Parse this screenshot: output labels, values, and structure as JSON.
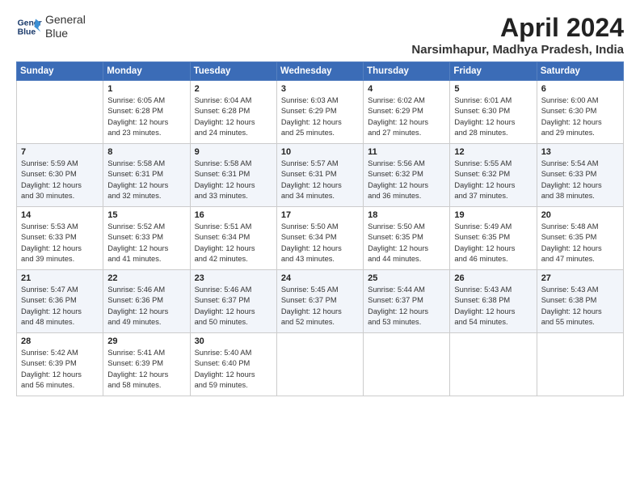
{
  "logo": {
    "line1": "General",
    "line2": "Blue"
  },
  "title": "April 2024",
  "subtitle": "Narsimhapur, Madhya Pradesh, India",
  "days_header": [
    "Sunday",
    "Monday",
    "Tuesday",
    "Wednesday",
    "Thursday",
    "Friday",
    "Saturday"
  ],
  "weeks": [
    [
      {
        "num": "",
        "content": ""
      },
      {
        "num": "1",
        "content": "Sunrise: 6:05 AM\nSunset: 6:28 PM\nDaylight: 12 hours\nand 23 minutes."
      },
      {
        "num": "2",
        "content": "Sunrise: 6:04 AM\nSunset: 6:28 PM\nDaylight: 12 hours\nand 24 minutes."
      },
      {
        "num": "3",
        "content": "Sunrise: 6:03 AM\nSunset: 6:29 PM\nDaylight: 12 hours\nand 25 minutes."
      },
      {
        "num": "4",
        "content": "Sunrise: 6:02 AM\nSunset: 6:29 PM\nDaylight: 12 hours\nand 27 minutes."
      },
      {
        "num": "5",
        "content": "Sunrise: 6:01 AM\nSunset: 6:30 PM\nDaylight: 12 hours\nand 28 minutes."
      },
      {
        "num": "6",
        "content": "Sunrise: 6:00 AM\nSunset: 6:30 PM\nDaylight: 12 hours\nand 29 minutes."
      }
    ],
    [
      {
        "num": "7",
        "content": "Sunrise: 5:59 AM\nSunset: 6:30 PM\nDaylight: 12 hours\nand 30 minutes."
      },
      {
        "num": "8",
        "content": "Sunrise: 5:58 AM\nSunset: 6:31 PM\nDaylight: 12 hours\nand 32 minutes."
      },
      {
        "num": "9",
        "content": "Sunrise: 5:58 AM\nSunset: 6:31 PM\nDaylight: 12 hours\nand 33 minutes."
      },
      {
        "num": "10",
        "content": "Sunrise: 5:57 AM\nSunset: 6:31 PM\nDaylight: 12 hours\nand 34 minutes."
      },
      {
        "num": "11",
        "content": "Sunrise: 5:56 AM\nSunset: 6:32 PM\nDaylight: 12 hours\nand 36 minutes."
      },
      {
        "num": "12",
        "content": "Sunrise: 5:55 AM\nSunset: 6:32 PM\nDaylight: 12 hours\nand 37 minutes."
      },
      {
        "num": "13",
        "content": "Sunrise: 5:54 AM\nSunset: 6:33 PM\nDaylight: 12 hours\nand 38 minutes."
      }
    ],
    [
      {
        "num": "14",
        "content": "Sunrise: 5:53 AM\nSunset: 6:33 PM\nDaylight: 12 hours\nand 39 minutes."
      },
      {
        "num": "15",
        "content": "Sunrise: 5:52 AM\nSunset: 6:33 PM\nDaylight: 12 hours\nand 41 minutes."
      },
      {
        "num": "16",
        "content": "Sunrise: 5:51 AM\nSunset: 6:34 PM\nDaylight: 12 hours\nand 42 minutes."
      },
      {
        "num": "17",
        "content": "Sunrise: 5:50 AM\nSunset: 6:34 PM\nDaylight: 12 hours\nand 43 minutes."
      },
      {
        "num": "18",
        "content": "Sunrise: 5:50 AM\nSunset: 6:35 PM\nDaylight: 12 hours\nand 44 minutes."
      },
      {
        "num": "19",
        "content": "Sunrise: 5:49 AM\nSunset: 6:35 PM\nDaylight: 12 hours\nand 46 minutes."
      },
      {
        "num": "20",
        "content": "Sunrise: 5:48 AM\nSunset: 6:35 PM\nDaylight: 12 hours\nand 47 minutes."
      }
    ],
    [
      {
        "num": "21",
        "content": "Sunrise: 5:47 AM\nSunset: 6:36 PM\nDaylight: 12 hours\nand 48 minutes."
      },
      {
        "num": "22",
        "content": "Sunrise: 5:46 AM\nSunset: 6:36 PM\nDaylight: 12 hours\nand 49 minutes."
      },
      {
        "num": "23",
        "content": "Sunrise: 5:46 AM\nSunset: 6:37 PM\nDaylight: 12 hours\nand 50 minutes."
      },
      {
        "num": "24",
        "content": "Sunrise: 5:45 AM\nSunset: 6:37 PM\nDaylight: 12 hours\nand 52 minutes."
      },
      {
        "num": "25",
        "content": "Sunrise: 5:44 AM\nSunset: 6:37 PM\nDaylight: 12 hours\nand 53 minutes."
      },
      {
        "num": "26",
        "content": "Sunrise: 5:43 AM\nSunset: 6:38 PM\nDaylight: 12 hours\nand 54 minutes."
      },
      {
        "num": "27",
        "content": "Sunrise: 5:43 AM\nSunset: 6:38 PM\nDaylight: 12 hours\nand 55 minutes."
      }
    ],
    [
      {
        "num": "28",
        "content": "Sunrise: 5:42 AM\nSunset: 6:39 PM\nDaylight: 12 hours\nand 56 minutes."
      },
      {
        "num": "29",
        "content": "Sunrise: 5:41 AM\nSunset: 6:39 PM\nDaylight: 12 hours\nand 58 minutes."
      },
      {
        "num": "30",
        "content": "Sunrise: 5:40 AM\nSunset: 6:40 PM\nDaylight: 12 hours\nand 59 minutes."
      },
      {
        "num": "",
        "content": ""
      },
      {
        "num": "",
        "content": ""
      },
      {
        "num": "",
        "content": ""
      },
      {
        "num": "",
        "content": ""
      }
    ]
  ]
}
